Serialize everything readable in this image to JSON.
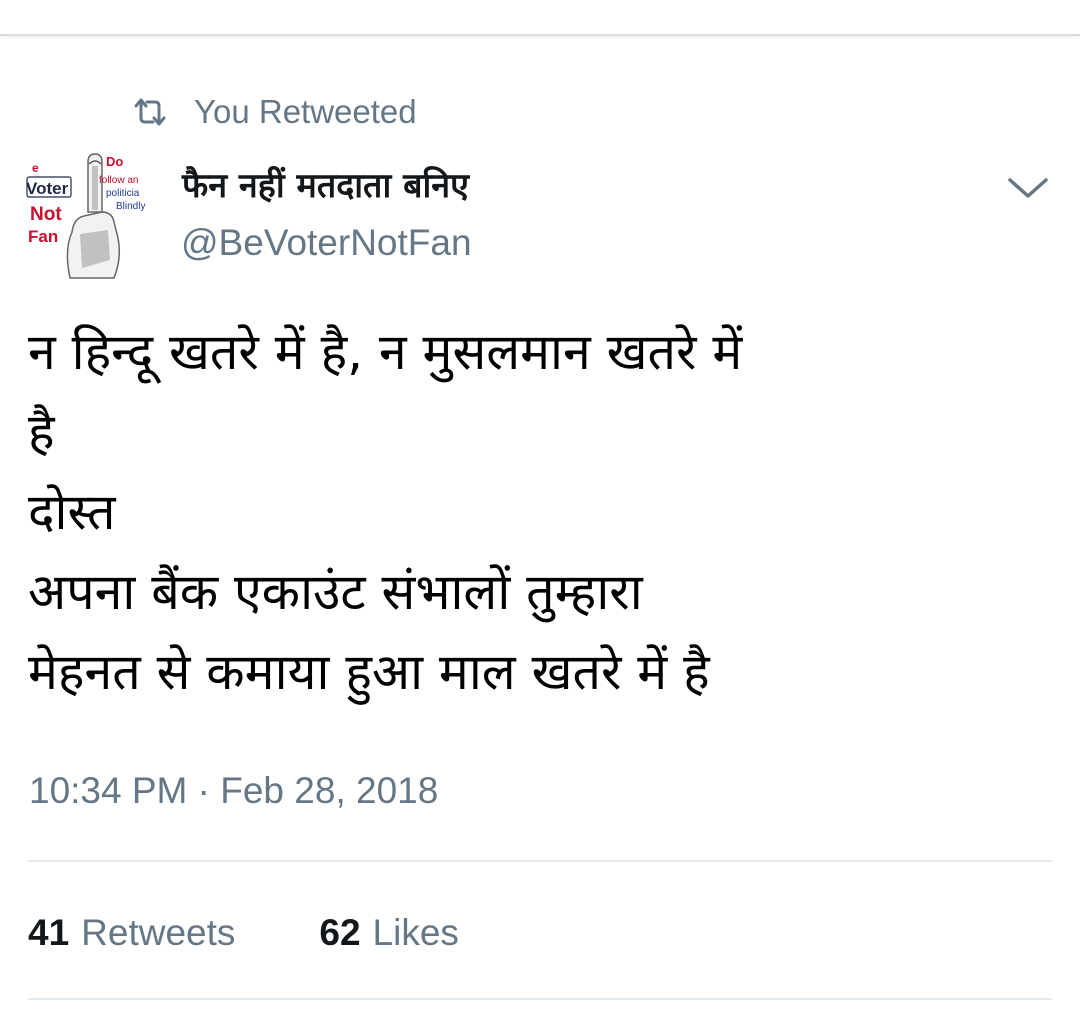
{
  "context": {
    "retweeted_label": "You Retweeted",
    "icon": "retweet-icon"
  },
  "author": {
    "display_name": "फैन नहीं मतदाता बनिए",
    "handle": "@BeVoterNotFan",
    "avatar_text": {
      "left_partial": "e",
      "voter": "Voter",
      "not": "Not",
      "fan": "Fan",
      "top_partial": "Do",
      "line1": "follow an",
      "line2": "politicia",
      "line3": "Blindly"
    }
  },
  "tweet": {
    "lines": [
      "न हिन्दू खतरे में है, न मुसलमान खतरे में",
      "है",
      "दोस्त",
      "अपना बैंक एकाउंट संभालों तुम्हारा",
      "मेहनत से कमाया हुआ माल खतरे में है"
    ],
    "timestamp": "10:34 PM · Feb 28, 2018"
  },
  "stats": {
    "retweets_count": "41",
    "retweets_label": "Retweets",
    "likes_count": "62",
    "likes_label": "Likes"
  },
  "colors": {
    "text_primary": "#14171a",
    "text_secondary": "#657786",
    "divider": "#e1e8ed",
    "avatar_red": "#c8102e",
    "avatar_blue": "#1f3a93"
  },
  "icons": {
    "caret": "chevron-down-icon"
  }
}
